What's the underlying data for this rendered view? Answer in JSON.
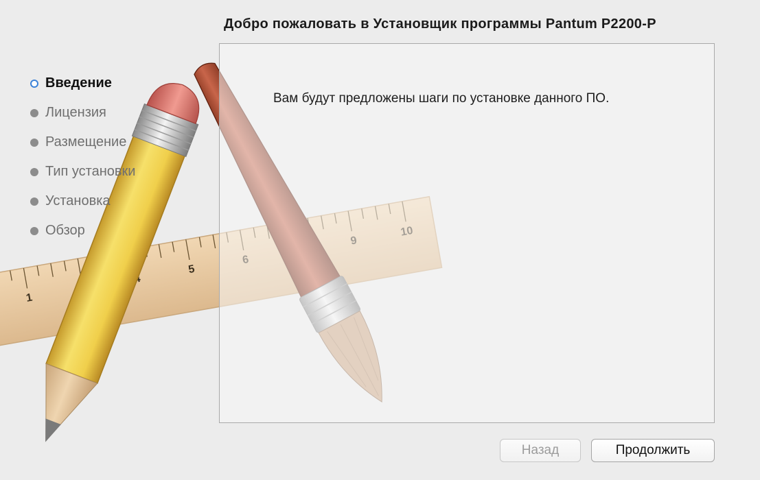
{
  "window": {
    "title": "Добро пожаловать в Установщик программы Pantum P2200-P"
  },
  "sidebar": {
    "steps": [
      {
        "label": "Введение",
        "state": "current"
      },
      {
        "label": "Лицензия",
        "state": "pending"
      },
      {
        "label": "Размещение",
        "state": "pending"
      },
      {
        "label": "Тип установки",
        "state": "pending"
      },
      {
        "label": "Установка",
        "state": "pending"
      },
      {
        "label": "Обзор",
        "state": "pending"
      }
    ]
  },
  "content": {
    "text": "Вам будут предложены шаги по установке данного ПО."
  },
  "buttons": {
    "back_label": "Назад",
    "back_enabled": false,
    "continue_label": "Продолжить"
  },
  "artwork": {
    "ruler_numbers": [
      "1",
      "4",
      "5",
      "6",
      "9",
      "10"
    ],
    "icons": [
      "pencil-icon",
      "ruler-icon",
      "paintbrush-icon"
    ],
    "colors": {
      "accent_bullet": "#3b82d8",
      "inactive_bullet": "#8c8c8c",
      "pencil_body": "#f0d255",
      "brush_handle": "#9b3a1c"
    }
  }
}
